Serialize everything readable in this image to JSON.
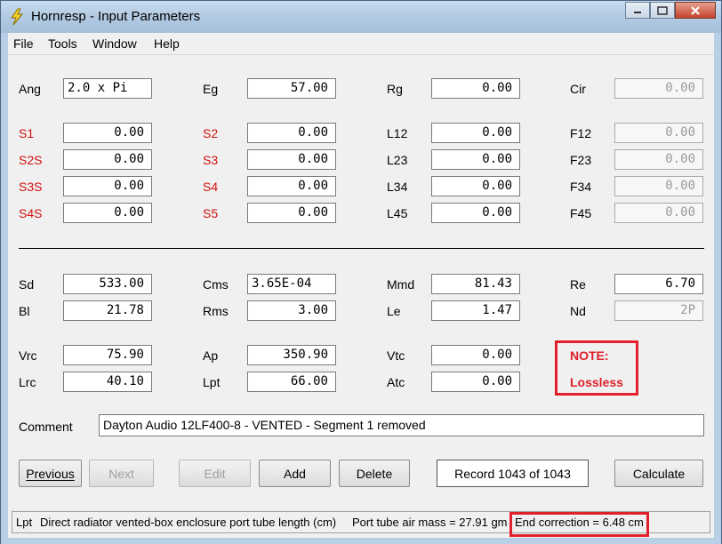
{
  "window": {
    "title": "Hornresp - Input Parameters"
  },
  "menu": {
    "file": "File",
    "tools": "Tools",
    "window": "Window",
    "help": "Help"
  },
  "row_ang": {
    "ang_label": "Ang",
    "ang_value": "2.0 x Pi",
    "eg_label": "Eg",
    "eg_value": "57.00",
    "rg_label": "Rg",
    "rg_value": "0.00",
    "cir_label": "Cir",
    "cir_value": "0.00"
  },
  "segments": [
    {
      "a_label": "S1",
      "a_value": "0.00",
      "b_label": "S2",
      "b_value": "0.00",
      "c_label": "L12",
      "c_value": "0.00",
      "d_label": "F12",
      "d_value": "0.00"
    },
    {
      "a_label": "S2S",
      "a_value": "0.00",
      "b_label": "S3",
      "b_value": "0.00",
      "c_label": "L23",
      "c_value": "0.00",
      "d_label": "F23",
      "d_value": "0.00"
    },
    {
      "a_label": "S3S",
      "a_value": "0.00",
      "b_label": "S4",
      "b_value": "0.00",
      "c_label": "L34",
      "c_value": "0.00",
      "d_label": "F34",
      "d_value": "0.00"
    },
    {
      "a_label": "S4S",
      "a_value": "0.00",
      "b_label": "S5",
      "b_value": "0.00",
      "c_label": "L45",
      "c_value": "0.00",
      "d_label": "F45",
      "d_value": "0.00"
    }
  ],
  "driver": {
    "sd_label": "Sd",
    "sd_value": "533.00",
    "cms_label": "Cms",
    "cms_value": "3.65E-04",
    "mmd_label": "Mmd",
    "mmd_value": "81.43",
    "re_label": "Re",
    "re_value": "6.70",
    "bl_label": "Bl",
    "bl_value": "21.78",
    "rms_label": "Rms",
    "rms_value": "3.00",
    "le_label": "Le",
    "le_value": "1.47",
    "nd_label": "Nd",
    "nd_value": "2P"
  },
  "chamber": {
    "vrc_label": "Vrc",
    "vrc_value": "75.90",
    "ap_label": "Ap",
    "ap_value": "350.90",
    "vtc_label": "Vtc",
    "vtc_value": "0.00",
    "lrc_label": "Lrc",
    "lrc_value": "40.10",
    "lpt_label": "Lpt",
    "lpt_value": "66.00",
    "atc_label": "Atc",
    "atc_value": "0.00"
  },
  "note": {
    "line1": "NOTE:",
    "line2": "Lossless"
  },
  "comment": {
    "label": "Comment",
    "value": "Dayton Audio 12LF400-8 - VENTED - Segment 1 removed"
  },
  "buttons": {
    "previous": "Previous",
    "next": "Next",
    "edit": "Edit",
    "add": "Add",
    "delete": "Delete",
    "calculate": "Calculate"
  },
  "record": "Record 1043 of 1043",
  "status": {
    "param": "Lpt",
    "description": "Direct radiator vented-box enclosure port tube length  (cm)",
    "air_mass": "Port tube air mass = 27.91 gm",
    "end_correction": "End correction = 6.48 cm"
  },
  "colors": {
    "label_red": "#d01010",
    "highlight": "#e0202a"
  }
}
